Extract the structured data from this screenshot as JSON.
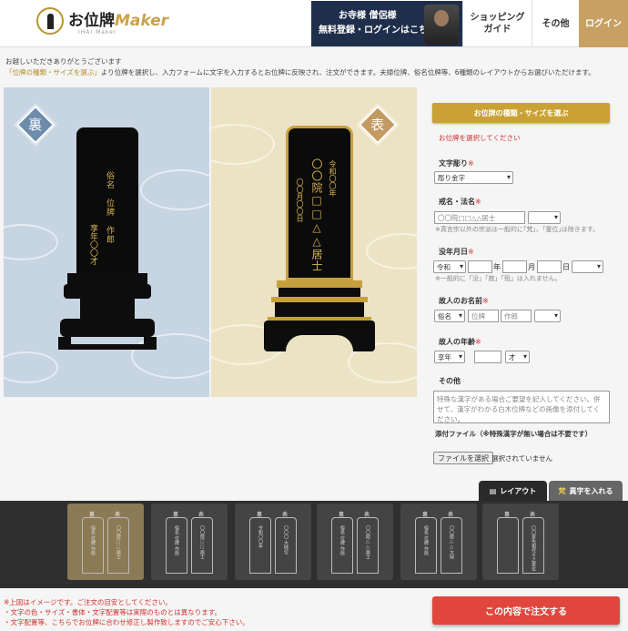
{
  "header": {
    "logo_text": "お位牌",
    "logo_maker": "Maker",
    "logo_sub": "IHAI Maker",
    "banner_line1": "お寺様 僧侶様",
    "banner_line2": "無料登録・ログインはこちら",
    "nav_guide": "ショッピングガイド",
    "nav_other": "その他",
    "nav_login": "ログイン"
  },
  "intro": {
    "line1": "お越しいただきありがとうございます",
    "line2_hl": "「位牌の種類・サイズを選ぶ」",
    "line2_rest": "より位牌を選択し、入力フォームに文字を入力するとお位牌に反映され、注文ができます。夫婦位牌、俗名位牌等、6種類のレイアウトからお選びいただけます。"
  },
  "preview": {
    "back_badge": "裏",
    "front_badge": "表",
    "back_col1": "俗名　位牌　作郎",
    "back_col2": "享年〇〇才",
    "front_main": "〇〇院□□△△居士",
    "front_left": "〇〇月〇〇日",
    "front_right": "令和〇〇年"
  },
  "form": {
    "select_type_button": "お位牌の種類・サイズを選ぶ",
    "select_type_error": "お位牌を選択してください",
    "moji_label": "文字彫り",
    "moji_value": "彫り金字",
    "kaimyo_label": "戒名・法名",
    "kaimyo_placeholder": "〇〇院□□△△居士",
    "kaimyo_note": "※真言宗以外の宗派は一般的に｢梵｣、｢霊位｣は除きます。",
    "date_label": "没年月日",
    "era_value": "令和",
    "unit_year": "年",
    "unit_month": "月",
    "unit_day": "日",
    "date_note": "※一般的に「没」「寂」「殁」は入れません。",
    "name_label": "故人のお名前",
    "name_prefix": "俗名",
    "name_last": "位牌",
    "name_first": "作郎",
    "age_label": "故人の年齢",
    "age_prefix": "享年",
    "age_unit": "才",
    "other_label": "その他",
    "other_placeholder": "特殊な漢字がある場合ご要望を記入してください。併せて、漢字がわかる白木位牌などの画像を添付してください。",
    "attach_label": "添付ファイル（※特殊漢字が無い場合は不要です）",
    "file_button": "ファイルを選択",
    "file_status": "選択されていません",
    "required_mark": "※"
  },
  "tabs": {
    "layout": "レイアウト",
    "external": "異字を入れる"
  },
  "layouts": [
    {
      "back": "裏",
      "front": "表",
      "t1": "俗名 位牌 作郎",
      "t2": "〇〇院□□居士"
    },
    {
      "back": "裏",
      "front": "表",
      "t1": "俗名 位牌 作郎",
      "t2": "〇〇院□□居士"
    },
    {
      "back": "裏",
      "front": "表",
      "t1": "令和〇〇年",
      "t2": "〇〇〇 大姉位"
    },
    {
      "back": "裏",
      "front": "表",
      "t1": "俗名 位牌 作郎",
      "t2": "〇〇院△△居士"
    },
    {
      "back": "裏",
      "front": "表",
      "t1": "俗名 位牌 作郎",
      "t2": "〇〇院△△大姉"
    },
    {
      "back": "裏",
      "front": "表",
      "t1": "",
      "t2": "〇〇家先祖代々之霊位"
    }
  ],
  "footer": {
    "note1": "※上図はイメージです。ご注文の目安としてください。",
    "note2": "・文字の色・サイズ・書体・文字配置等は実際のものとは異なります。",
    "note3": "・文字配置等、こちらでお位牌に合わせ修正し製作致しますのでご安心下さい。",
    "order_button": "この内容で注文する"
  },
  "colors": {
    "gold": "#c9a233",
    "order": "#e0463d",
    "back_panel": "#c7d4e2",
    "front_panel": "#ece3c4"
  }
}
